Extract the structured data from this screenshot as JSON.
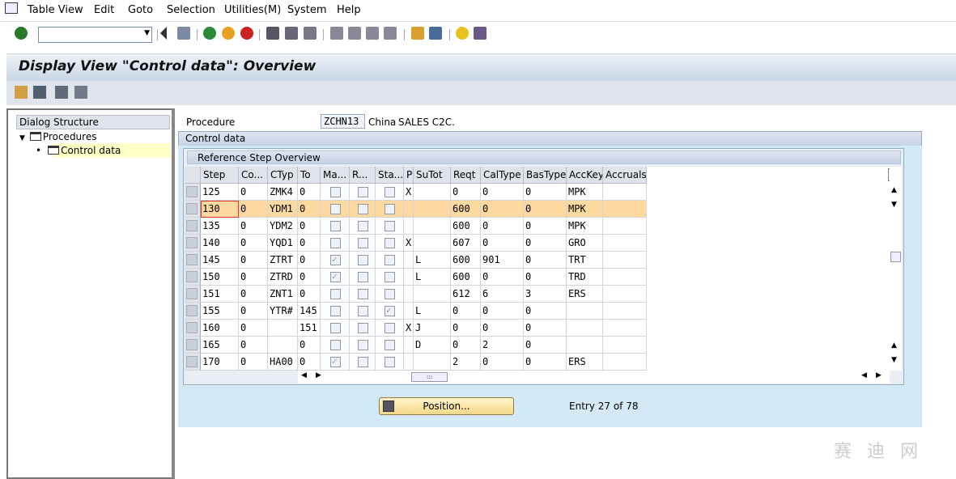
{
  "menu": [
    "Table View",
    "Edit",
    "Goto",
    "Selection",
    "Utilities(M)",
    "System",
    "Help"
  ],
  "title": "Display View \"Control data\": Overview",
  "dialog_structure": {
    "header": "Dialog Structure",
    "items": [
      "Procedures",
      "Control data"
    ]
  },
  "procedure": {
    "label": "Procedure",
    "code": "ZCHN13",
    "country": "China",
    "desc": "SALES C2C."
  },
  "control_data_label": "Control data",
  "group_title": "Reference Step Overview",
  "columns": [
    "Step",
    "Co...",
    "CTyp",
    "To",
    "Ma...",
    "R...",
    "Sta...",
    "P",
    "SuTot",
    "Reqt",
    "CalType",
    "BasType",
    "AccKey",
    "Accruals"
  ],
  "rows": [
    {
      "step": "125",
      "co": "0",
      "ctyp": "ZMK4",
      "to": "0",
      "ma": false,
      "r": false,
      "sta": false,
      "p": "X",
      "sutot": "",
      "reqt": "0",
      "cal": "0",
      "bas": "0",
      "acc": "MPK",
      "accr": ""
    },
    {
      "step": "130",
      "co": "0",
      "ctyp": "YDM1",
      "to": "0",
      "ma": false,
      "r": false,
      "sta": false,
      "p": "",
      "sutot": "",
      "reqt": "600",
      "cal": "0",
      "bas": "0",
      "acc": "MPK",
      "accr": ""
    },
    {
      "step": "135",
      "co": "0",
      "ctyp": "YDM2",
      "to": "0",
      "ma": false,
      "r": false,
      "sta": false,
      "p": "",
      "sutot": "",
      "reqt": "600",
      "cal": "0",
      "bas": "0",
      "acc": "MPK",
      "accr": ""
    },
    {
      "step": "140",
      "co": "0",
      "ctyp": "YQD1",
      "to": "0",
      "ma": false,
      "r": false,
      "sta": false,
      "p": "X",
      "sutot": "",
      "reqt": "607",
      "cal": "0",
      "bas": "0",
      "acc": "GRO",
      "accr": ""
    },
    {
      "step": "145",
      "co": "0",
      "ctyp": "ZTRT",
      "to": "0",
      "ma": true,
      "r": false,
      "sta": false,
      "p": "",
      "sutot": "L",
      "reqt": "600",
      "cal": "901",
      "bas": "0",
      "acc": "TRT",
      "accr": ""
    },
    {
      "step": "150",
      "co": "0",
      "ctyp": "ZTRD",
      "to": "0",
      "ma": true,
      "r": false,
      "sta": false,
      "p": "",
      "sutot": "L",
      "reqt": "600",
      "cal": "0",
      "bas": "0",
      "acc": "TRD",
      "accr": ""
    },
    {
      "step": "151",
      "co": "0",
      "ctyp": "ZNT1",
      "to": "0",
      "ma": false,
      "r": false,
      "sta": false,
      "p": "",
      "sutot": "",
      "reqt": "612",
      "cal": "6",
      "bas": "3",
      "acc": "ERS",
      "accr": ""
    },
    {
      "step": "155",
      "co": "0",
      "ctyp": "YTR#",
      "to": "145",
      "ma": false,
      "r": false,
      "sta": true,
      "p": "",
      "sutot": "L",
      "reqt": "0",
      "cal": "0",
      "bas": "0",
      "acc": "",
      "accr": ""
    },
    {
      "step": "160",
      "co": "0",
      "ctyp": "",
      "to": "151",
      "ma": false,
      "r": false,
      "sta": false,
      "p": "X",
      "sutot": "J",
      "reqt": "0",
      "cal": "0",
      "bas": "0",
      "acc": "",
      "accr": ""
    },
    {
      "step": "165",
      "co": "0",
      "ctyp": "",
      "to": "0",
      "ma": false,
      "r": false,
      "sta": false,
      "p": "",
      "sutot": "D",
      "reqt": "0",
      "cal": "2",
      "bas": "0",
      "acc": "",
      "accr": ""
    },
    {
      "step": "170",
      "co": "0",
      "ctyp": "HA00",
      "to": "0",
      "ma": true,
      "r": false,
      "sta": false,
      "p": "",
      "sutot": "",
      "reqt": "2",
      "cal": "0",
      "bas": "0",
      "acc": "ERS",
      "accr": ""
    }
  ],
  "highlighted_row": 1,
  "position_button": "Position...",
  "entry_text": "Entry 27 of 78",
  "hscroll_grip": ":::",
  "watermark": "赛 迪 网",
  "colors": {
    "highlight": "#fdd9a0",
    "panel": "#d3eaf6",
    "selected_tree": "#ffffc8"
  }
}
